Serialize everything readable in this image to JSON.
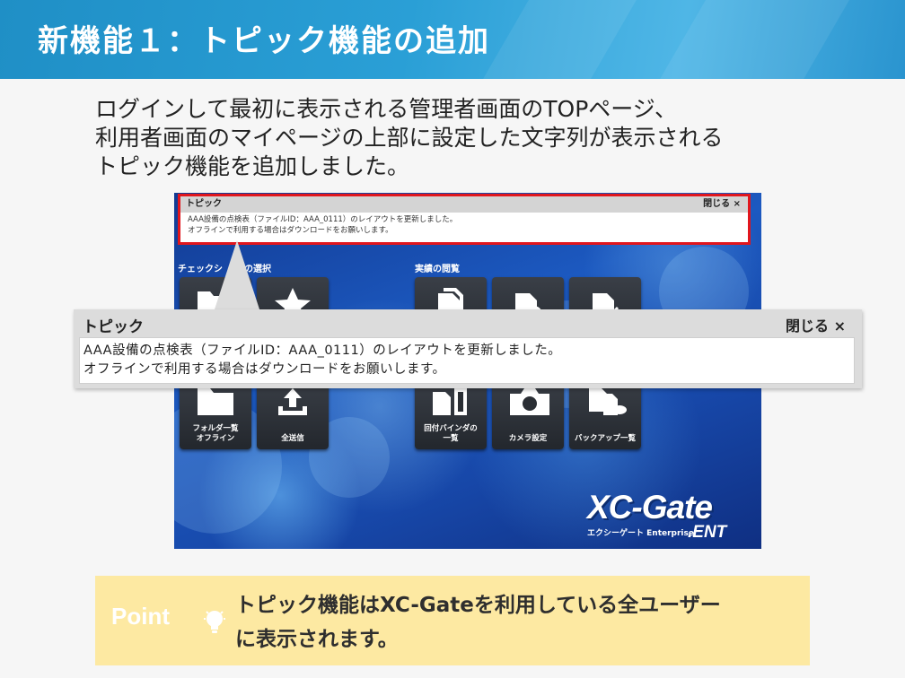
{
  "slide": {
    "title": "新機能１：トピック機能の追加",
    "intro_lines": [
      "ログインして最初に表示される管理者画面のTOPページ、",
      "利用者画面のマイページの上部に設定した文字列が表示される",
      "トピック機能を追加しました。"
    ]
  },
  "screenshot": {
    "topic_title": "トピック",
    "close_label": "閉じる ×",
    "messages": [
      "AAA設備の点検表（ファイルID：AAA_0111）のレイアウトを更新しました。",
      "オフラインで利用する場合はダウンロードをお願いします。"
    ],
    "left_section": "チェックシートの選択",
    "left_section_visible": "チェックシ",
    "left_section_tail": "の選択",
    "right_section": "実績の閲覧",
    "tiles": [
      {
        "label": "フォルダ一覧\nオフライン",
        "icon": "folder-icon"
      },
      {
        "label": "全送信",
        "icon": "upload-icon"
      },
      {
        "label": "回付バインダの\n一覧",
        "icon": "binder-icon"
      },
      {
        "label": "カメラ設定",
        "icon": "camera-icon"
      },
      {
        "label": "バックアップ一覧",
        "icon": "backup-icon"
      }
    ],
    "logo_main": "XC-Gate",
    "logo_sub": "エクシーゲート Enterprise",
    "logo_ent": ".ENT"
  },
  "zoom": {
    "title": "トピック",
    "close_label": "閉じる ×",
    "messages": [
      "AAA設備の点検表（ファイルID：AAA_0111）のレイアウトを更新しました。",
      "オフラインで利用する場合はダウンロードをお願いします。"
    ]
  },
  "point": {
    "label": "Point",
    "icon": "lightbulb-icon",
    "lines": [
      "トピック機能はXC-Gateを利用している全ユーザー",
      "に表示されます。"
    ]
  },
  "colors": {
    "header": "#2a9fd6",
    "highlight_border": "#e1161d",
    "point_bg": "#fde9a2"
  }
}
